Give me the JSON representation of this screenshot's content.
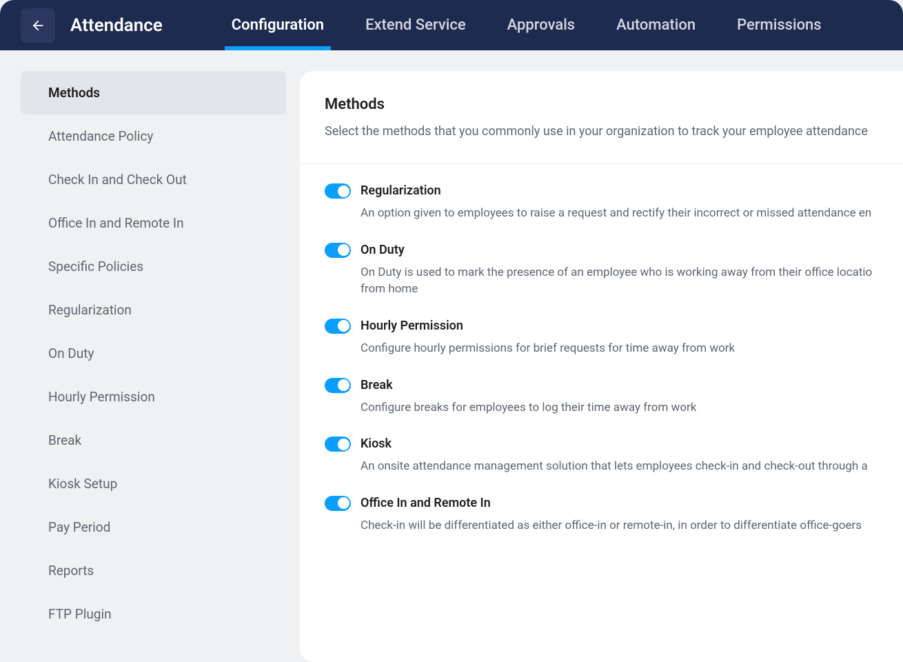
{
  "header": {
    "title": "Attendance",
    "tabs": [
      {
        "label": "Configuration",
        "active": true
      },
      {
        "label": "Extend Service",
        "active": false
      },
      {
        "label": "Approvals",
        "active": false
      },
      {
        "label": "Automation",
        "active": false
      },
      {
        "label": "Permissions",
        "active": false
      }
    ]
  },
  "sidebar": {
    "items": [
      {
        "label": "Methods",
        "active": true
      },
      {
        "label": "Attendance Policy",
        "active": false
      },
      {
        "label": "Check In and Check Out",
        "active": false
      },
      {
        "label": "Office In and Remote In",
        "active": false
      },
      {
        "label": "Specific Policies",
        "active": false
      },
      {
        "label": "Regularization",
        "active": false
      },
      {
        "label": "On Duty",
        "active": false
      },
      {
        "label": "Hourly Permission",
        "active": false
      },
      {
        "label": "Break",
        "active": false
      },
      {
        "label": "Kiosk Setup",
        "active": false
      },
      {
        "label": "Pay Period",
        "active": false
      },
      {
        "label": "Reports",
        "active": false
      },
      {
        "label": "FTP Plugin",
        "active": false
      }
    ]
  },
  "main": {
    "title": "Methods",
    "subtitle": "Select the methods that you commonly use in your organization to track your employee attendance",
    "methods": [
      {
        "title": "Regularization",
        "desc": "An option given to employees to raise a request and rectify their incorrect or missed attendance en",
        "enabled": true
      },
      {
        "title": "On Duty",
        "desc": "On Duty is used to mark the presence of an employee who is working away from their office locatio\nfrom home",
        "enabled": true
      },
      {
        "title": "Hourly Permission",
        "desc": "Configure hourly permissions for brief requests for time away from work",
        "enabled": true
      },
      {
        "title": "Break",
        "desc": "Configure breaks for employees to log their time away from work",
        "enabled": true
      },
      {
        "title": "Kiosk",
        "desc": "An onsite attendance management solution that lets employees check-in and check-out through a",
        "enabled": true
      },
      {
        "title": "Office In and Remote In",
        "desc": "Check-in will be differentiated as either office-in or remote-in, in order to differentiate office-goers ",
        "enabled": true
      }
    ]
  }
}
